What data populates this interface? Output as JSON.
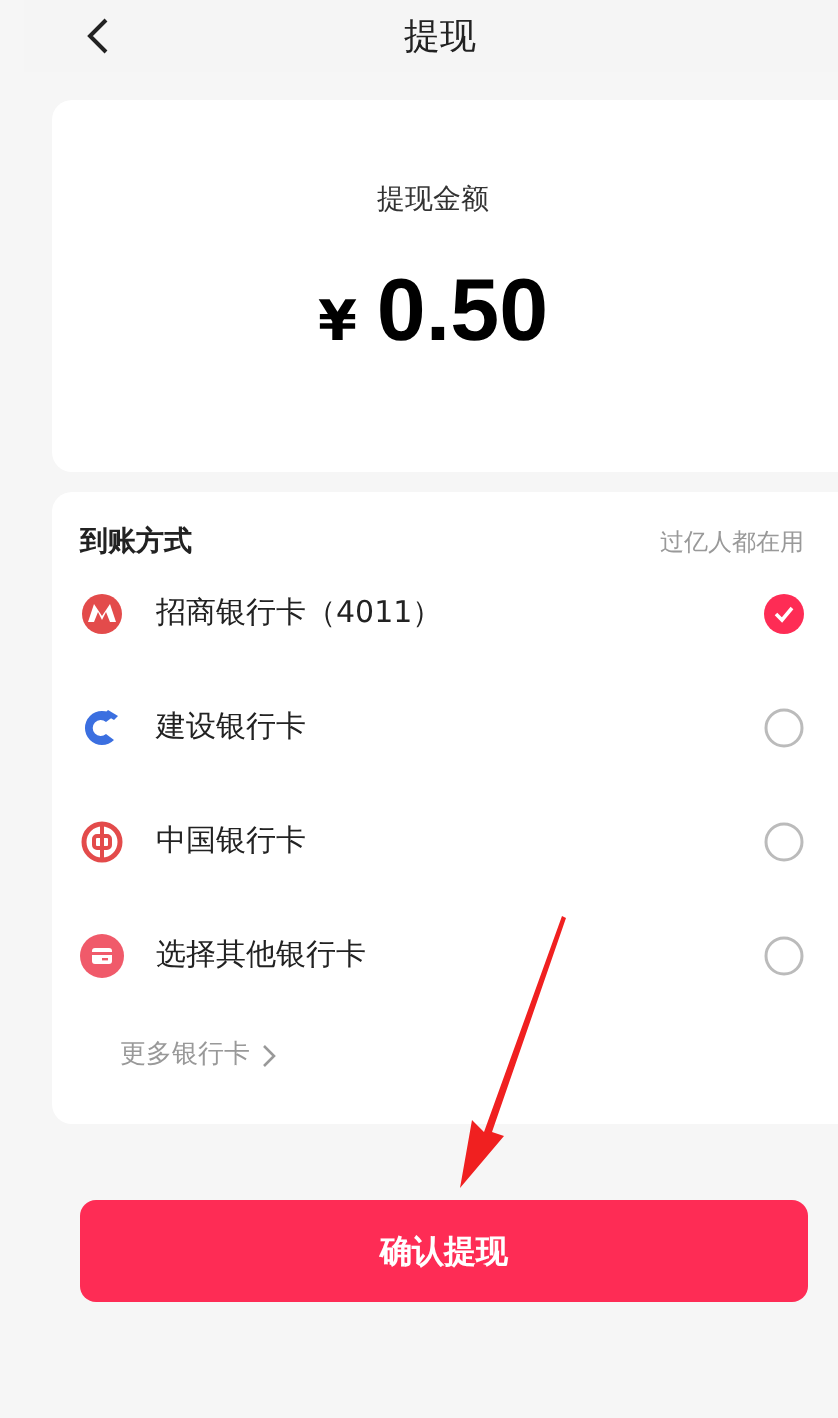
{
  "header": {
    "title": "提现"
  },
  "amount_card": {
    "label": "提现金额",
    "currency": "¥",
    "amount": "0.50"
  },
  "payout": {
    "title": "到账方式",
    "note": "过亿人都在用",
    "options": [
      {
        "kind": "cmb",
        "label": "招商银行卡（4011）",
        "selected": true
      },
      {
        "kind": "ccb",
        "label": "建设银行卡",
        "selected": false
      },
      {
        "kind": "boc",
        "label": "中国银行卡",
        "selected": false
      },
      {
        "kind": "other",
        "label": "选择其他银行卡",
        "selected": false
      }
    ],
    "more": "更多银行卡"
  },
  "confirm_button": "确认提现"
}
